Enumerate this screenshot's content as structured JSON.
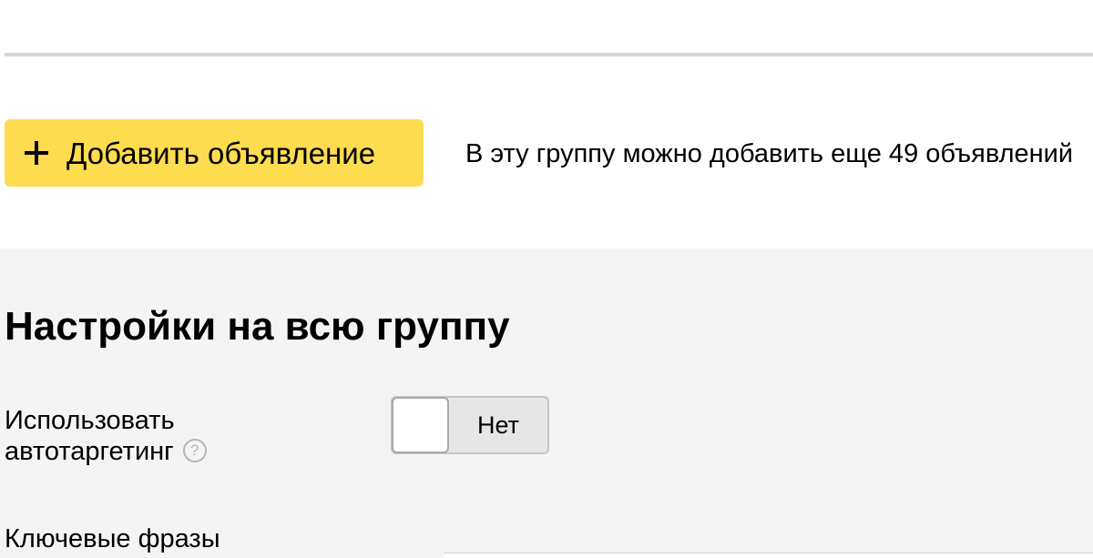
{
  "actions": {
    "add_ad_label": "Добавить объявление",
    "add_ad_icon": "plus-icon",
    "add_hint": "В эту группу можно добавить еще 49 объявлений"
  },
  "group_settings": {
    "title": "Настройки на всю группу",
    "autotargeting": {
      "label_line1": "Использовать",
      "label_line2": "автотаргетинг",
      "help_icon": "question-icon",
      "help_glyph": "?",
      "toggle_value": "Нет",
      "enabled": false
    },
    "keywords": {
      "label": "Ключевые фразы"
    }
  },
  "colors": {
    "accent_button": "#fddc4f",
    "panel_background": "#f4f4f4",
    "divider": "#d6d6d6"
  }
}
